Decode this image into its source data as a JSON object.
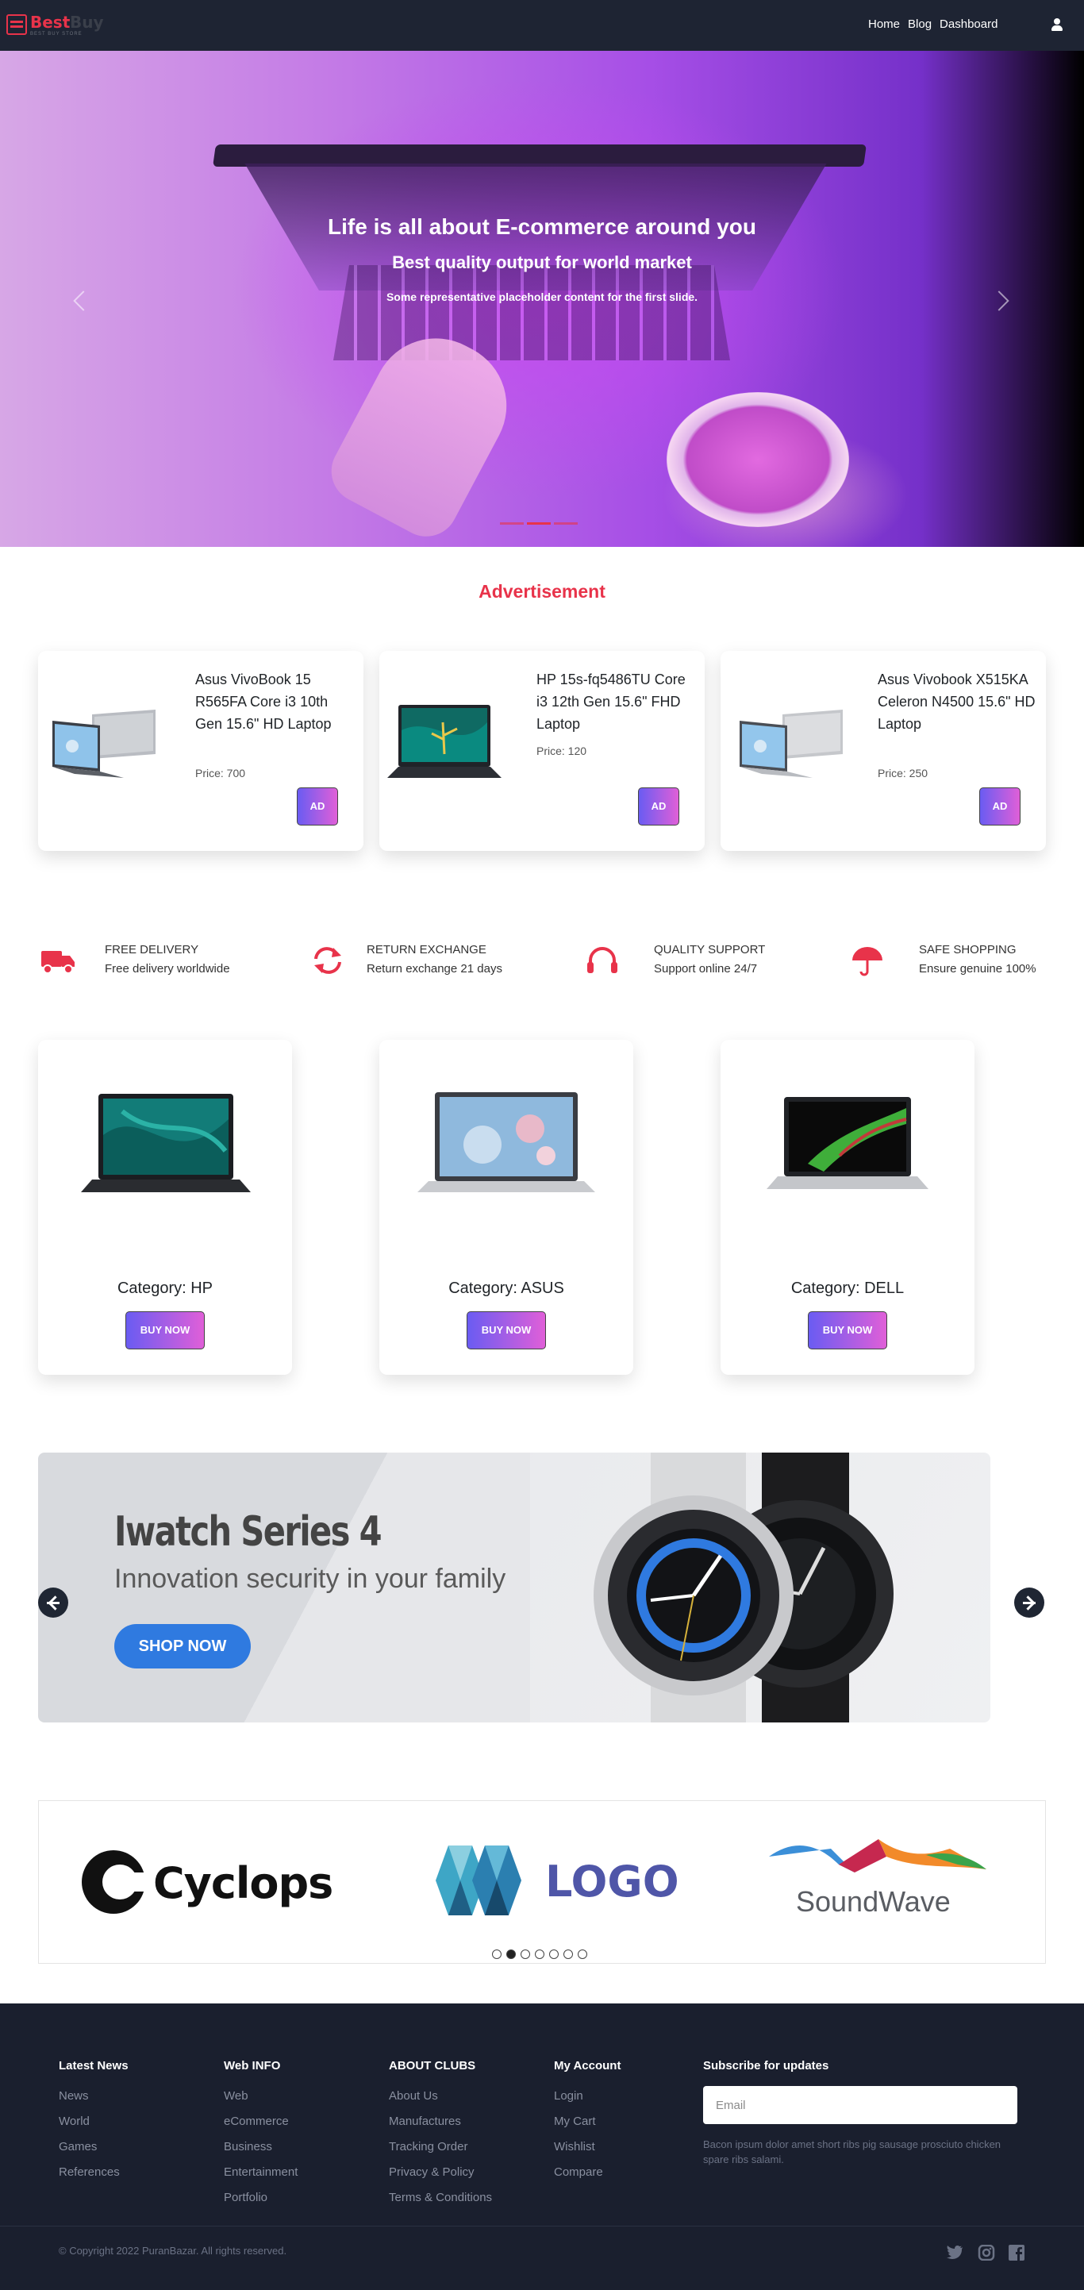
{
  "navbar": {
    "brand": "Best",
    "brand_dim": "Buy",
    "brand_tagline": "BEST BUY STORE",
    "links": [
      "Home",
      "Blog",
      "Dashboard"
    ],
    "user_icon": "user-icon"
  },
  "hero": {
    "title": "Life is all about E-commerce around you",
    "subtitle": "Best quality output for world market",
    "description": "Some representative placeholder content for the first slide.",
    "slides": 3,
    "active_slide": 2
  },
  "advertisement": {
    "title": "Advertisement",
    "items": [
      {
        "name": "Asus VivoBook 15 R565FA Core i3 10th Gen 15.6\" HD Laptop",
        "price": "Price: 700",
        "button": "AD"
      },
      {
        "name": "HP 15s-fq5486TU Core i3 12th Gen 15.6\" FHD Laptop",
        "price": "Price: 120",
        "button": "AD"
      },
      {
        "name": "Asus Vivobook X515KA Celeron N4500 15.6\" HD Laptop",
        "price": "Price: 250",
        "button": "AD"
      }
    ]
  },
  "features": [
    {
      "icon": "truck-icon",
      "title": "FREE DELIVERY",
      "desc": "Free delivery worldwide"
    },
    {
      "icon": "refresh-icon",
      "title": "RETURN EXCHANGE",
      "desc": "Return exchange 21 days"
    },
    {
      "icon": "headphones-icon",
      "title": "QUALITY SUPPORT",
      "desc": "Support online 24/7"
    },
    {
      "icon": "umbrella-icon",
      "title": "SAFE SHOPPING",
      "desc": "Ensure genuine 100%"
    }
  ],
  "categories": [
    {
      "label": "Category: HP",
      "button": "BUY NOW"
    },
    {
      "label": "Category: ASUS",
      "button": "BUY NOW"
    },
    {
      "label": "Category: DELL",
      "button": "BUY NOW"
    }
  ],
  "banner": {
    "title": "Iwatch Series 4",
    "subtitle": "Innovation security in your family",
    "button": "SHOP NOW"
  },
  "brands": {
    "items": [
      "Cyclops",
      "LOGO",
      "SoundWave"
    ],
    "dot_count": 7,
    "active_dot": 2
  },
  "footer": {
    "columns": [
      {
        "heading": "Latest News",
        "links": [
          "News",
          "World",
          "Games",
          "References"
        ]
      },
      {
        "heading": "Web INFO",
        "links": [
          "Web",
          "eCommerce",
          "Business",
          "Entertainment",
          "Portfolio"
        ]
      },
      {
        "heading": "ABOUT CLUBS",
        "links": [
          "About Us",
          "Manufactures",
          "Tracking Order",
          "Privacy & Policy",
          "Terms & Conditions"
        ]
      },
      {
        "heading": "My Account",
        "links": [
          "Login",
          "My Cart",
          "Wishlist",
          "Compare"
        ]
      }
    ],
    "subscribe": {
      "heading": "Subscribe for updates",
      "placeholder": "Email",
      "note": "Bacon ipsum dolor amet short ribs pig sausage prosciuto chicken spare ribs salami."
    },
    "copyright": "© Copyright 2022 PuranBazar. All rights reserved.",
    "social": [
      "twitter-icon",
      "instagram-icon",
      "facebook-icon"
    ]
  },
  "colors": {
    "accent": "#e8334a",
    "navbar_bg": "#1e2433",
    "footer_bg": "#1a1f2e",
    "button_gradient_start": "#6a5cf2",
    "button_gradient_end": "#e05fd8",
    "shop_now": "#2f7ae0"
  }
}
